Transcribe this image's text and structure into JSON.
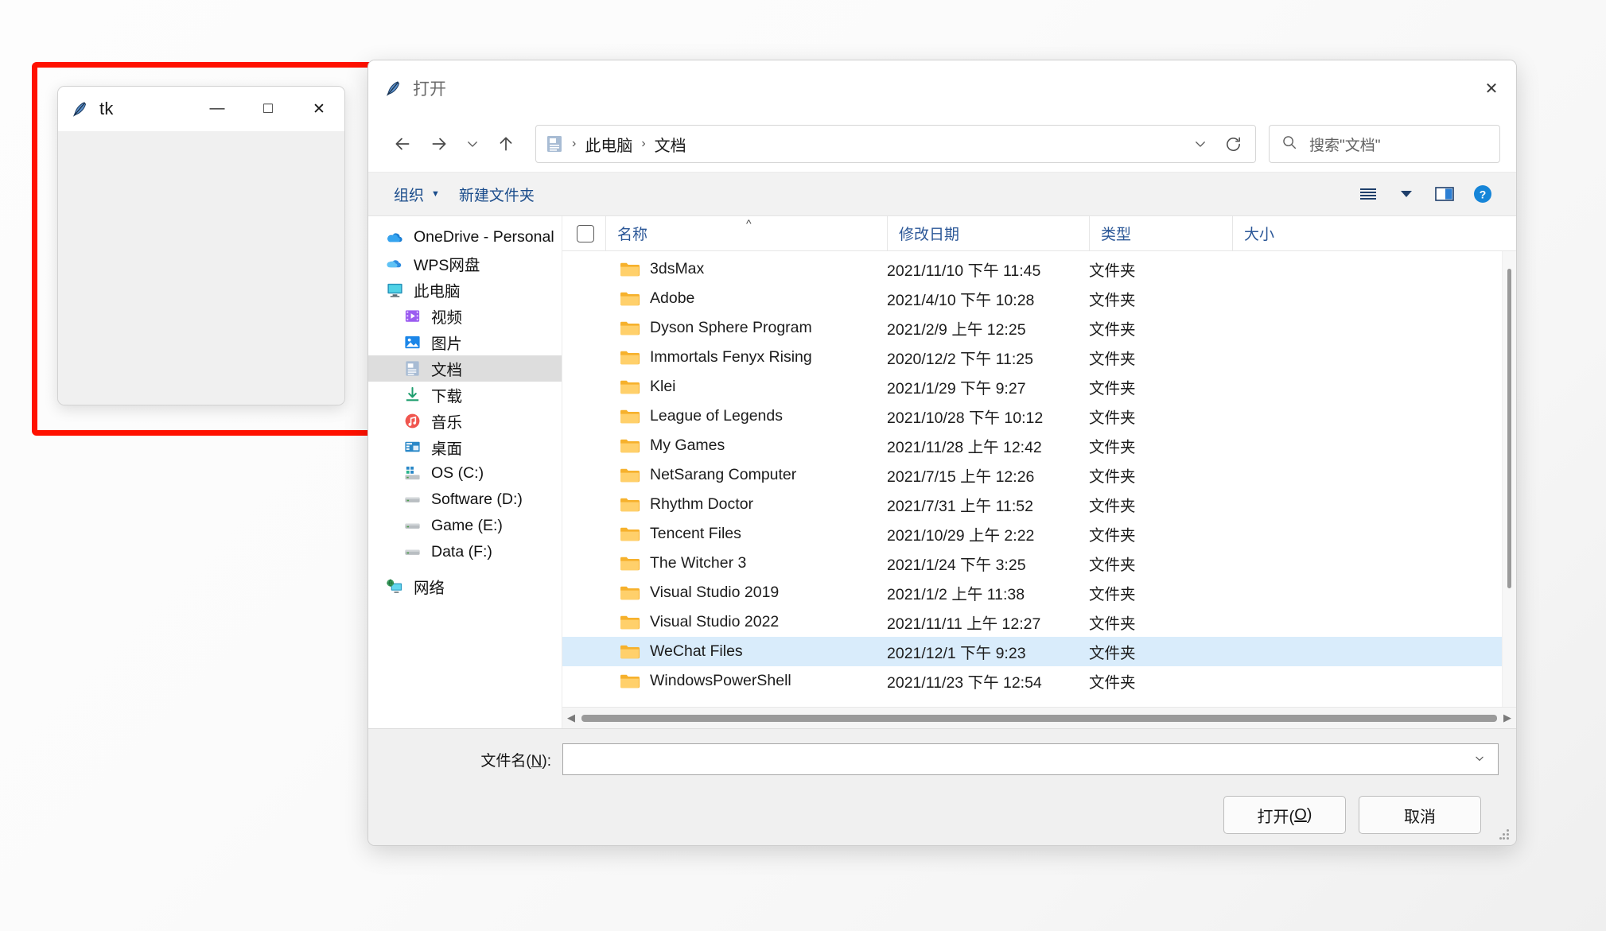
{
  "tk_window": {
    "title": "tk",
    "icon": "feather-icon",
    "controls": {
      "minimize": "—",
      "maximize": "□",
      "close": "✕"
    }
  },
  "highlight": {
    "color": "#ff1100"
  },
  "dialog": {
    "title": "打开",
    "icon": "feather-icon",
    "close_label": "✕",
    "nav": {
      "back": "←",
      "forward": "→",
      "recent": "⌄",
      "up": "↑"
    },
    "address": {
      "icon": "documents-icon",
      "crumbs": [
        "此电脑",
        "文档"
      ],
      "separator": "›",
      "history_chevron": "⌄",
      "refresh": "⟳"
    },
    "search": {
      "icon": "search-icon",
      "placeholder": "搜索\"文档\""
    },
    "command_bar": {
      "organize": "组织",
      "organize_caret": "▼",
      "new_folder": "新建文件夹",
      "view_icon": "view-list-icon",
      "view_caret": "▼",
      "preview_pane_icon": "preview-pane-icon",
      "help_icon": "help-icon"
    },
    "sidebar": {
      "items": [
        {
          "label": "OneDrive - Personal",
          "icon": "onedrive-icon",
          "indent": false,
          "selected": false
        },
        {
          "label": "WPS网盘",
          "icon": "wps-cloud-icon",
          "indent": false,
          "selected": false
        },
        {
          "label": "此电脑",
          "icon": "this-pc-icon",
          "indent": false,
          "selected": false
        },
        {
          "label": "视频",
          "icon": "videos-icon",
          "indent": true,
          "selected": false
        },
        {
          "label": "图片",
          "icon": "pictures-icon",
          "indent": true,
          "selected": false
        },
        {
          "label": "文档",
          "icon": "documents-icon",
          "indent": true,
          "selected": true
        },
        {
          "label": "下载",
          "icon": "downloads-icon",
          "indent": true,
          "selected": false
        },
        {
          "label": "音乐",
          "icon": "music-icon",
          "indent": true,
          "selected": false
        },
        {
          "label": "桌面",
          "icon": "desktop-icon",
          "indent": true,
          "selected": false
        },
        {
          "label": "OS (C:)",
          "icon": "os-drive-icon",
          "indent": true,
          "selected": false
        },
        {
          "label": "Software (D:)",
          "icon": "drive-icon",
          "indent": true,
          "selected": false
        },
        {
          "label": "Game (E:)",
          "icon": "drive-icon",
          "indent": true,
          "selected": false
        },
        {
          "label": "Data (F:)",
          "icon": "drive-icon",
          "indent": true,
          "selected": false
        },
        {
          "label": "网络",
          "icon": "network-icon",
          "indent": false,
          "selected": false
        }
      ]
    },
    "file_list": {
      "columns": [
        "名称",
        "修改日期",
        "类型",
        "大小"
      ],
      "sort_indicator": "^",
      "rows": [
        {
          "name": "3dsMax",
          "date": "2021/11/10 下午 11:45",
          "type": "文件夹",
          "size": "",
          "selected": false
        },
        {
          "name": "Adobe",
          "date": "2021/4/10 下午 10:28",
          "type": "文件夹",
          "size": "",
          "selected": false
        },
        {
          "name": "Dyson Sphere Program",
          "date": "2021/2/9 上午 12:25",
          "type": "文件夹",
          "size": "",
          "selected": false
        },
        {
          "name": "Immortals Fenyx Rising",
          "date": "2020/12/2 下午 11:25",
          "type": "文件夹",
          "size": "",
          "selected": false
        },
        {
          "name": "Klei",
          "date": "2021/1/29 下午 9:27",
          "type": "文件夹",
          "size": "",
          "selected": false
        },
        {
          "name": "League of Legends",
          "date": "2021/10/28 下午 10:12",
          "type": "文件夹",
          "size": "",
          "selected": false
        },
        {
          "name": "My Games",
          "date": "2021/11/28 上午 12:42",
          "type": "文件夹",
          "size": "",
          "selected": false
        },
        {
          "name": "NetSarang Computer",
          "date": "2021/7/15 上午 12:26",
          "type": "文件夹",
          "size": "",
          "selected": false
        },
        {
          "name": "Rhythm Doctor",
          "date": "2021/7/31 上午 11:52",
          "type": "文件夹",
          "size": "",
          "selected": false
        },
        {
          "name": "Tencent Files",
          "date": "2021/10/29 上午 2:22",
          "type": "文件夹",
          "size": "",
          "selected": false
        },
        {
          "name": "The Witcher 3",
          "date": "2021/1/24 下午 3:25",
          "type": "文件夹",
          "size": "",
          "selected": false
        },
        {
          "name": "Visual Studio 2019",
          "date": "2021/1/2 上午 11:38",
          "type": "文件夹",
          "size": "",
          "selected": false
        },
        {
          "name": "Visual Studio 2022",
          "date": "2021/11/11 上午 12:27",
          "type": "文件夹",
          "size": "",
          "selected": false
        },
        {
          "name": "WeChat Files",
          "date": "2021/12/1 下午 9:23",
          "type": "文件夹",
          "size": "",
          "selected": true
        },
        {
          "name": "WindowsPowerShell",
          "date": "2021/11/23 下午 12:54",
          "type": "文件夹",
          "size": "",
          "selected": false
        }
      ]
    },
    "footer": {
      "filename_label": "文件名(N):",
      "filename_value": "",
      "filename_chevron": "⌄",
      "open_button": "打开(O)",
      "cancel_button": "取消"
    }
  }
}
